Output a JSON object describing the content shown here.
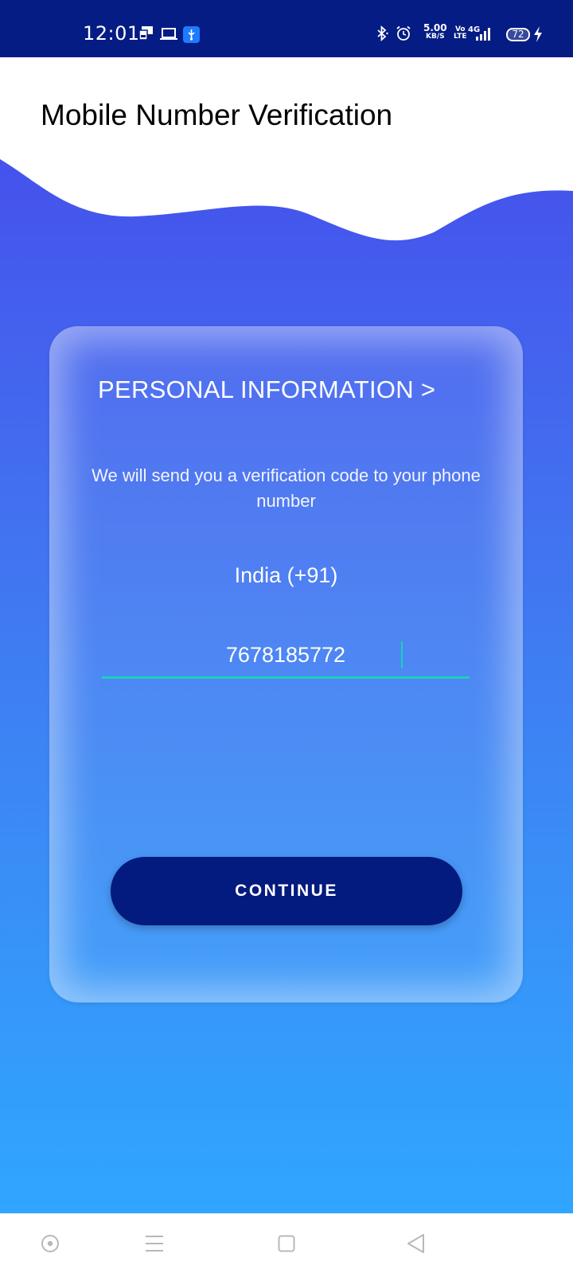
{
  "status_bar": {
    "time": "12:01",
    "net_speed_value": "5.00",
    "net_speed_unit": "KB/S",
    "volte_top": "Vo",
    "volte_bottom": "LTE",
    "network": "4G",
    "battery": "72",
    "icons": [
      "presentation-icon",
      "laptop-icon",
      "usb-icon",
      "bluetooth-icon",
      "alarm-icon",
      "signal-icon",
      "charging-icon"
    ]
  },
  "header": {
    "title": "Mobile Number Verification"
  },
  "card": {
    "title": "PERSONAL INFORMATION  >",
    "description": "We will send you a verification code to your phone number",
    "country": "India (+91)",
    "phone_value": "7678185772",
    "continue_label": "CONTINUE"
  },
  "nav_bar": {
    "icons": [
      "home-circle-icon",
      "menu-icon",
      "recents-square-icon",
      "back-triangle-icon"
    ]
  },
  "colors": {
    "status_bar": "#051c84",
    "gradient_top": "#4552ec",
    "gradient_bottom": "#2fa6ff",
    "button": "#031a7e",
    "input_underline": "#18d1b8"
  }
}
